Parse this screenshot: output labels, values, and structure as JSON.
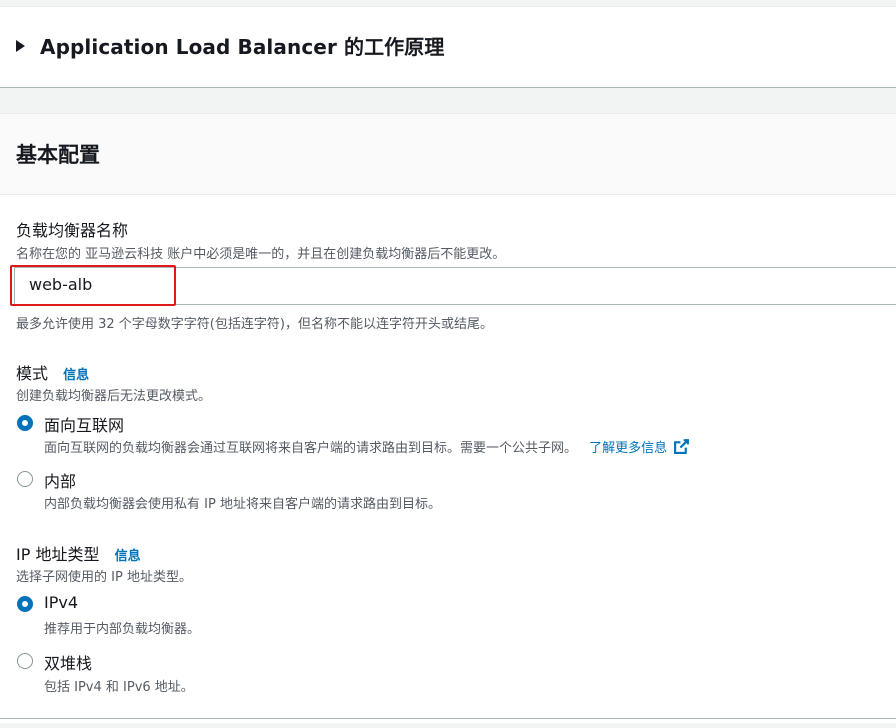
{
  "expander": {
    "title": "Application Load Balancer 的工作原理"
  },
  "basic": {
    "title": "基本配置",
    "name_field": {
      "label": "负载均衡器名称",
      "description": "名称在您的 亚马逊云科技 账户中必须是唯一的，并且在创建负载均衡器后不能更改。",
      "value": "web-alb",
      "constraint": "最多允许使用 32 个字母数字字符(包括连字符)，但名称不能以连字符开头或结尾。"
    },
    "scheme": {
      "label": "模式",
      "info": "信息",
      "description": "创建负载均衡器后无法更改模式。",
      "options": [
        {
          "label": "面向互联网",
          "description": "面向互联网的负载均衡器会通过互联网将来自客户端的请求路由到目标。需要一个公共子网。",
          "link": "了解更多信息",
          "selected": true
        },
        {
          "label": "内部",
          "description": "内部负载均衡器会使用私有 IP 地址将来自客户端的请求路由到目标。",
          "selected": false
        }
      ]
    },
    "ip_type": {
      "label": "IP 地址类型",
      "info": "信息",
      "description": "选择子网使用的 IP 地址类型。",
      "options": [
        {
          "label": "IPv4",
          "description": "推荐用于内部负载均衡器。",
          "selected": true
        },
        {
          "label": "双堆栈",
          "description": "包括 IPv4 和 IPv6 地址。",
          "selected": false
        }
      ]
    }
  },
  "colors": {
    "accent": "#0073bb",
    "highlight": "#e11818",
    "text": "#16191f",
    "secondary_text": "#545b64"
  }
}
